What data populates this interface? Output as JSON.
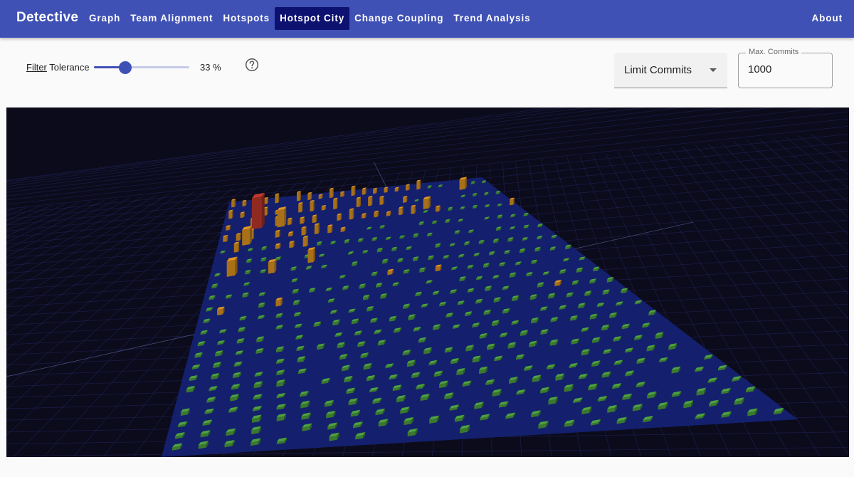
{
  "app": {
    "title": "Detective"
  },
  "nav": {
    "items": [
      {
        "label": "Graph",
        "active": false
      },
      {
        "label": "Team Alignment",
        "active": false
      },
      {
        "label": "Hotspots",
        "active": false
      },
      {
        "label": "Hotspot City",
        "active": true
      },
      {
        "label": "Change Coupling",
        "active": false
      },
      {
        "label": "Trend Analysis",
        "active": false
      }
    ],
    "about": "About"
  },
  "filter": {
    "label_underlined": "Filter",
    "label_rest": " Tolerance",
    "tolerance_value": 33,
    "tolerance_text": "33 %",
    "help_icon": "help-circle-icon"
  },
  "limit": {
    "selected": "Limit Commits",
    "max_label": "Max. Commits",
    "max_value": "1000"
  },
  "city": {
    "colors": {
      "background": "#0b0b1c",
      "grid": "#23235a",
      "ground": "#14206e",
      "cold": "#4a9a3c",
      "warm": "#d7901f",
      "hot": "#b8362a"
    }
  }
}
